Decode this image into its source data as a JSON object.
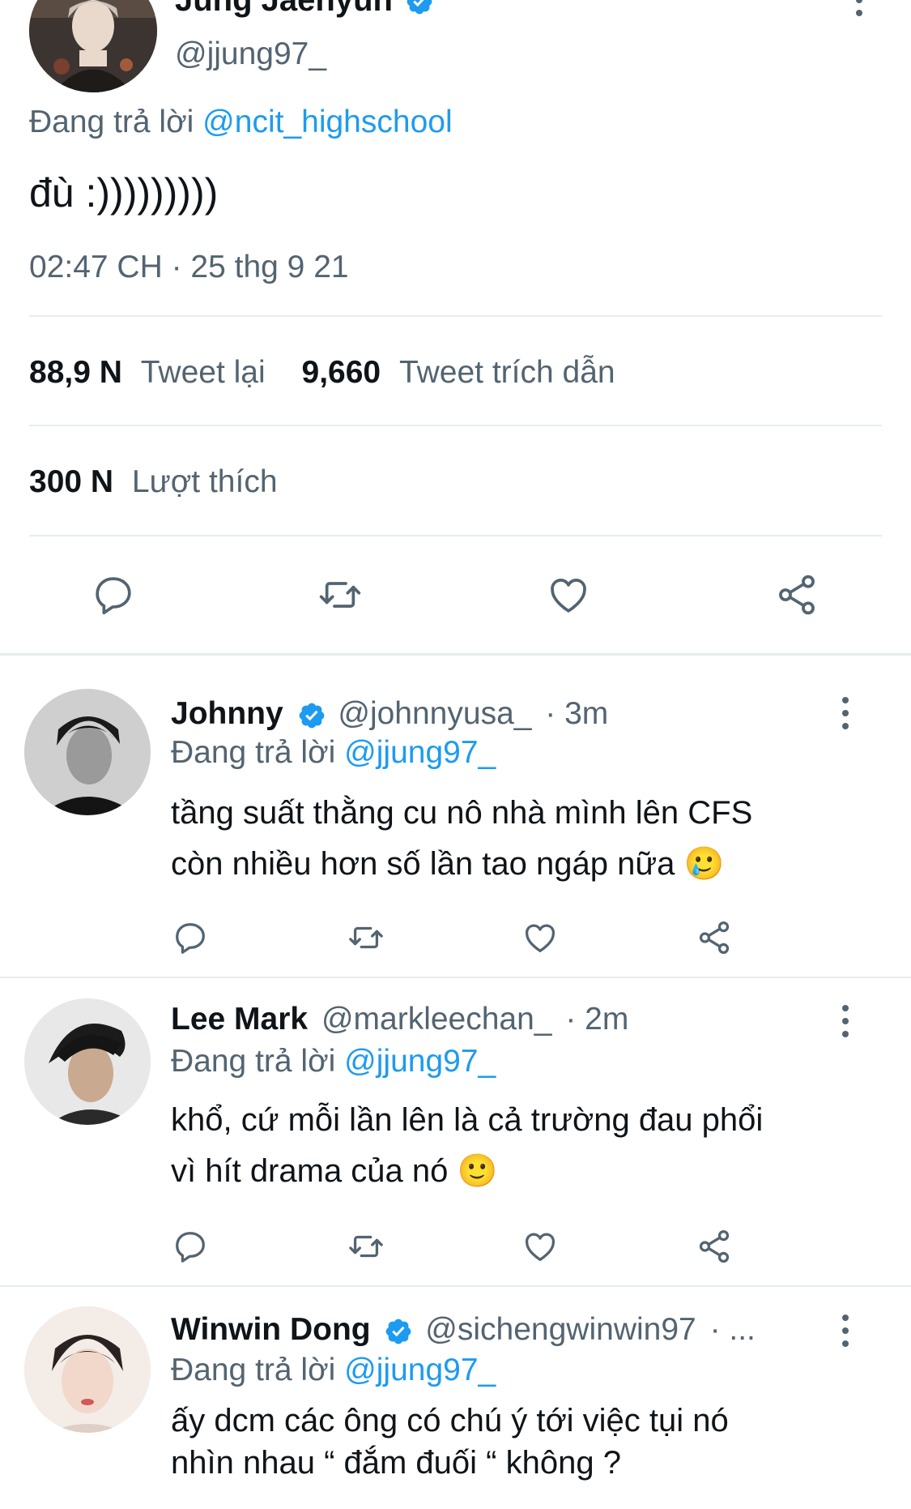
{
  "main_tweet": {
    "display_name": "Jung Jaehyun",
    "handle": "@jjung97_",
    "reply_prefix": "Đang trả lời",
    "reply_to": "@ncit_highschool",
    "text": "đù :)))))))))",
    "timestamp": "02:47 CH · 25 thg 9 21",
    "retweets_count": "88,9 N",
    "retweets_label": "Tweet lại",
    "quotes_count": "9,660",
    "quotes_label": "Tweet trích dẫn",
    "likes_count": "300 N",
    "likes_label": "Lượt thích"
  },
  "replies": [
    {
      "display_name": "Johnny",
      "verified": true,
      "handle": "@johnnyusa_",
      "time": "· 3m",
      "reply_prefix": "Đang trả lời",
      "reply_to": "@jjung97_",
      "line1": "tầng suất thằng cu nô nhà mình lên CFS",
      "line2": "còn nhiều hơn số lần tao ngáp nữa",
      "emoji": "🥲"
    },
    {
      "display_name": "Lee Mark",
      "verified": false,
      "handle": "@markleechan_",
      "time": "· 2m",
      "reply_prefix": "Đang trả lời",
      "reply_to": "@jjung97_",
      "line1": "khổ, cứ mỗi lần lên là cả trường đau phổi",
      "line2": "vì hít drama của nó",
      "emoji": "🙂"
    },
    {
      "display_name": "Winwin Dong",
      "verified": true,
      "handle": "@sichengwinwin97",
      "time": "· ...",
      "reply_prefix": "Đang trả lời",
      "reply_to": "@jjung97_",
      "line1": "ấy dcm các ông có chú ý tới việc tụi nó",
      "line2": "nhìn nhau “ đắm đuối “ không ?",
      "emoji": ""
    }
  ],
  "colors": {
    "accent": "#1d9bf0",
    "secondary_text": "#536471",
    "divider": "#e6ecf0"
  },
  "icons": [
    "reply-icon",
    "retweet-icon",
    "like-icon",
    "share-icon",
    "more-options-icon",
    "verified-badge-icon"
  ]
}
